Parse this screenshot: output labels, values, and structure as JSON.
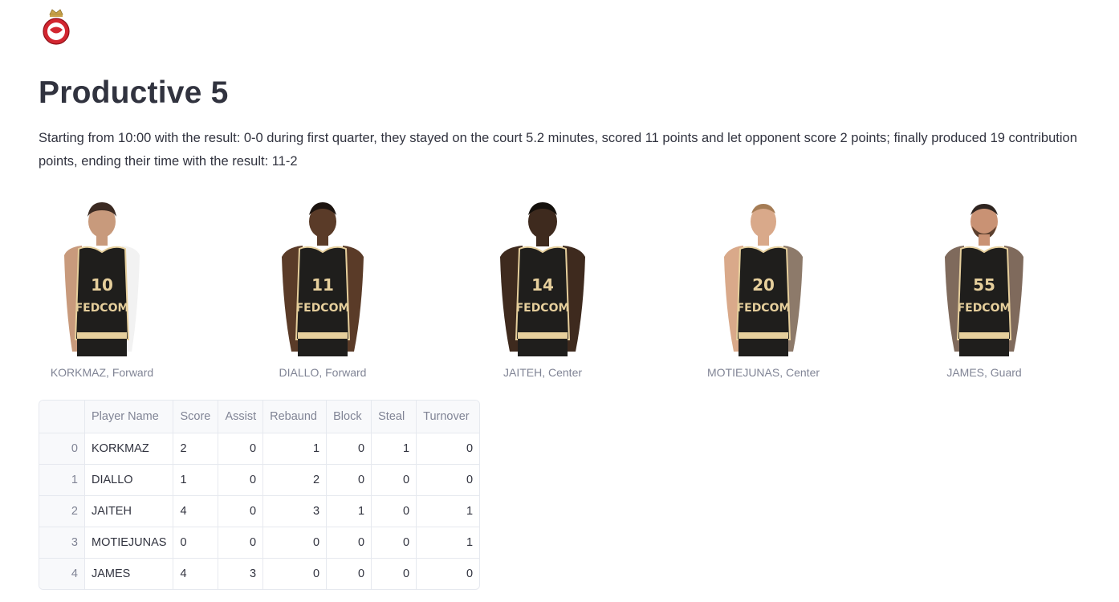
{
  "header": {
    "title": "Productive 5",
    "summary": "Starting from 10:00 with the result: 0-0 during first quarter, they stayed on the court 5.2 minutes, scored 11 points and let opponent score 2 points; finally produced 19 contribution points, ending their time with the result: 11-2"
  },
  "colors": {
    "jersey": "#1f1e1c",
    "trim": "#e6cf9c",
    "logo_red": "#d22630",
    "text": "#31333f",
    "muted": "#808495"
  },
  "players": [
    {
      "caption": "KORKMAZ, Forward",
      "number": "10",
      "sponsor": "FEDCOM"
    },
    {
      "caption": "DIALLO, Forward",
      "number": "11",
      "sponsor": "FEDCOM"
    },
    {
      "caption": "JAITEH, Center",
      "number": "14",
      "sponsor": "FEDCOM"
    },
    {
      "caption": "MOTIEJUNAS, Center",
      "number": "20",
      "sponsor": "FEDCOM"
    },
    {
      "caption": "JAMES, Guard",
      "number": "55",
      "sponsor": "FEDCOM"
    }
  ],
  "table": {
    "columns": [
      "",
      "Player Name",
      "Score",
      "Assist",
      "Rebaund",
      "Block",
      "Steal",
      "Turnover"
    ],
    "rows": [
      {
        "index": "0",
        "cells": [
          "KORKMAZ",
          "2",
          "0",
          "1",
          "0",
          "1",
          "0"
        ]
      },
      {
        "index": "1",
        "cells": [
          "DIALLO",
          "1",
          "0",
          "2",
          "0",
          "0",
          "0"
        ]
      },
      {
        "index": "2",
        "cells": [
          "JAITEH",
          "4",
          "0",
          "3",
          "1",
          "0",
          "1"
        ]
      },
      {
        "index": "3",
        "cells": [
          "MOTIEJUNAS",
          "0",
          "0",
          "0",
          "0",
          "0",
          "1"
        ]
      },
      {
        "index": "4",
        "cells": [
          "JAMES",
          "4",
          "3",
          "0",
          "0",
          "0",
          "0"
        ]
      }
    ]
  }
}
